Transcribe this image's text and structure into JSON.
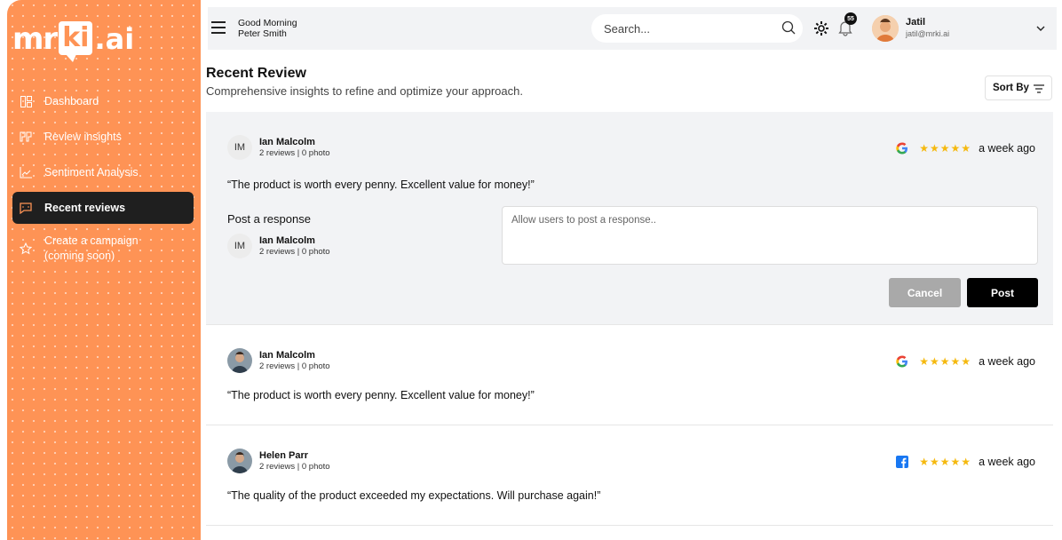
{
  "sidebar": {
    "logo": {
      "part1": "mr",
      "part2": "ki",
      "part3": ".ai"
    },
    "items": [
      {
        "label": "Dashboard",
        "icon": "dashboard-icon"
      },
      {
        "label": "Review insights",
        "icon": "quote-icon"
      },
      {
        "label": "Sentiment Analysis",
        "icon": "chart-icon"
      },
      {
        "label": "Recent reviews",
        "icon": "message-icon"
      },
      {
        "label": "Create a campaign",
        "label2": "(coming soon)",
        "icon": "star-icon"
      }
    ],
    "active_color": "#1f1f1f",
    "accent": "#fe9355"
  },
  "header": {
    "greeting": "Good Morning",
    "name": "Peter Smith",
    "search_placeholder": "Search...",
    "notifications": "55",
    "user_name": "Jatil",
    "user_email": "jatil@mrki.ai"
  },
  "page": {
    "title": "Recent Review",
    "subtitle": "Comprehensive insights to refine and optimize your approach.",
    "sort_label": "Sort By"
  },
  "reviews": [
    {
      "initials": "IM",
      "name": "Ian Malcolm",
      "meta": "2 reviews | 0 photo",
      "source": "google",
      "stars": "★★★★★",
      "time": "a week ago",
      "text": "“The product is worth every penny. Excellent value for money!”",
      "response": {
        "label": "Post a response",
        "initials": "IM",
        "name": "Ian Malcolm",
        "meta": "2 reviews | 0 photo",
        "placeholder": "Allow users to post a response..",
        "cancel": "Cancel",
        "post": "Post"
      }
    },
    {
      "name": "Ian Malcolm",
      "meta": "2 reviews | 0 photo",
      "source": "google",
      "stars": "★★★★★",
      "time": "a week ago",
      "text": "“The product is worth every penny. Excellent value for money!”"
    },
    {
      "name": "Helen Parr",
      "meta": "2 reviews | 0 photo",
      "source": "facebook",
      "stars": "★★★★★",
      "time": "a week ago",
      "text": "“The quality of the product exceeded my expectations. Will purchase again!”"
    }
  ]
}
